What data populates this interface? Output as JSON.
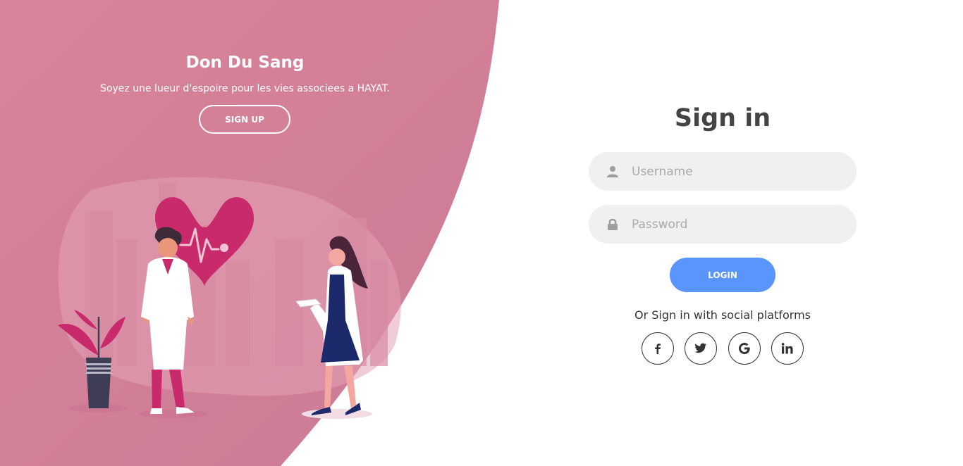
{
  "hero": {
    "title": "Don Du Sang",
    "subtitle": "Soyez une lueur d'espoire pour les vies associees a HAYAT.",
    "signup_label": "SIGN UP"
  },
  "signin": {
    "title": "Sign in",
    "username_placeholder": "Username",
    "password_placeholder": "Password",
    "login_label": "LOGIN",
    "social_text": "Or Sign in with social platforms",
    "social": [
      {
        "icon": "facebook-icon",
        "glyph": "f"
      },
      {
        "icon": "twitter-icon",
        "glyph": "t"
      },
      {
        "icon": "google-icon",
        "glyph": "G"
      },
      {
        "icon": "linkedin-icon",
        "glyph": "in"
      }
    ]
  },
  "colors": {
    "panel": "#d37e96",
    "accent": "#5995fd",
    "heart": "#c92a6c",
    "input_bg": "#f0f0f0"
  }
}
